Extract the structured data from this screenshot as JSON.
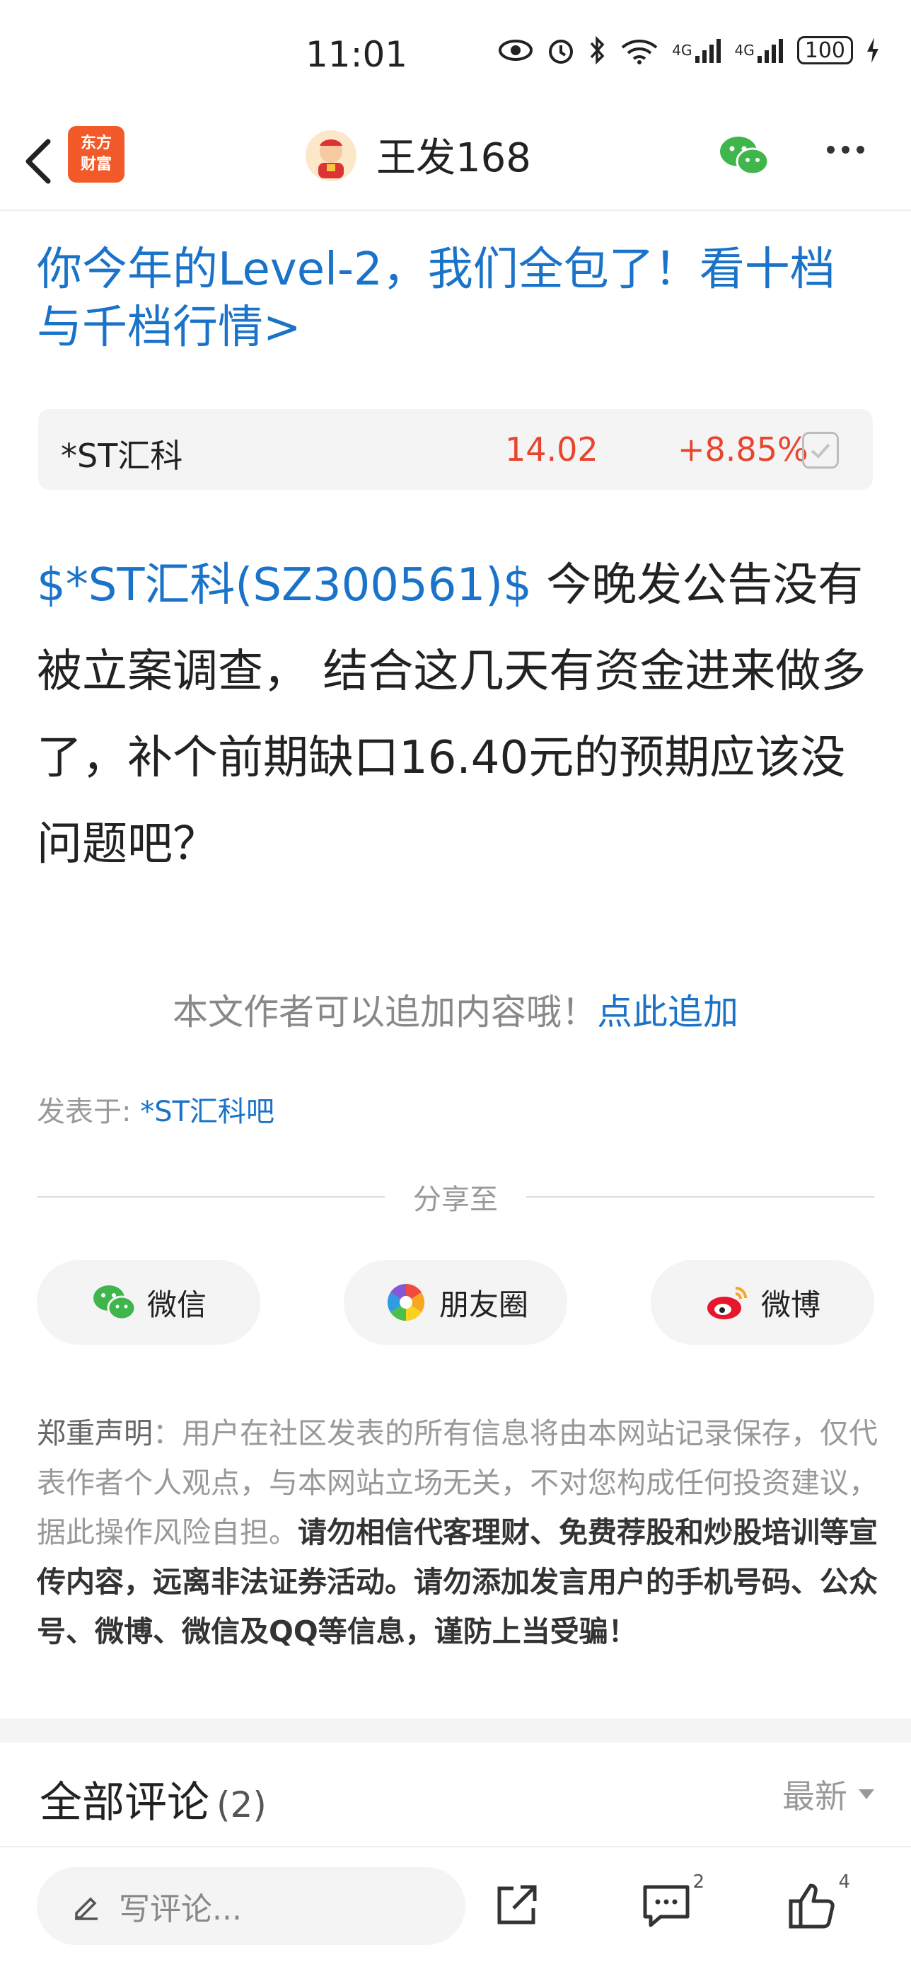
{
  "status_bar": {
    "time": "11:01",
    "battery": "100",
    "net1": "4G",
    "net2": "4G",
    "wifi_tag": "6"
  },
  "nav": {
    "title": "王发168",
    "logo_text_line1": "东方",
    "logo_text_line2": "财富"
  },
  "promo": {
    "text": "你今年的Level-2，我们全包了！看十档与千档行情>"
  },
  "stock": {
    "name": "*ST汇科",
    "price": "14.02",
    "change": "+8.85%",
    "color": "#e8452e"
  },
  "post": {
    "tag": "$*ST汇科(SZ300561)$",
    "body": " 今晚发公告没有被立案调查， 结合这几天有资金进来做多了，补个前期缺口16.40元的预期应该没问题吧？"
  },
  "append": {
    "prompt": "本文作者可以追加内容哦！",
    "link": "点此追加"
  },
  "posted_in": {
    "label": "发表于: ",
    "bar": "*ST汇科吧"
  },
  "share": {
    "title": "分享至",
    "wechat": "微信",
    "moments": "朋友圈",
    "weibo": "微博"
  },
  "disclaimer": {
    "lead": "郑重声明",
    "normal": "：用户在社区发表的所有信息将由本网站记录保存，仅代表作者个人观点，与本网站立场无关，不对您构成任何投资建议，据此操作风险自担。",
    "bold": "请勿相信代客理财、免费荐股和炒股培训等宣传内容，远离非法证券活动。请勿添加发言用户的手机号码、公众号、微博、微信及QQ等信息，谨防上当受骗！"
  },
  "comments": {
    "title": "全部评论",
    "count": "(2)",
    "sort": "最新"
  },
  "bottom_bar": {
    "placeholder": "写评论...",
    "reply_count": "2",
    "like_count": "4"
  },
  "colors": {
    "link_blue": "#1a73c8",
    "up_red": "#e8452e",
    "brand_orange": "#f25a29",
    "wechat_green": "#3fb54c"
  }
}
